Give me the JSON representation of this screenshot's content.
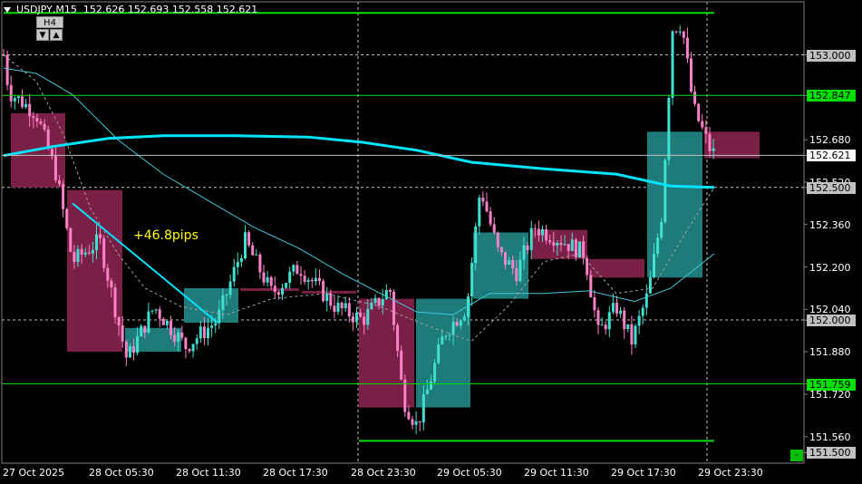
{
  "header": {
    "symbol_tf": "USDJPY,M15",
    "ohlc": "152.626 152.693 152.558 152.621"
  },
  "timeframe_widget": {
    "label": "H4",
    "down_label": "▼",
    "up_label": "▲"
  },
  "annotation": "+46.8pips",
  "minus_button": "-",
  "colors": {
    "background": "#000000",
    "bull_candle": "#40e0d0",
    "bear_candle": "#ff82c8",
    "h4_bear_box": "#7a1f45",
    "h4_bull_box": "#1f7a7a",
    "ma_slow": "#00e5ff",
    "ma_fast": "#40c8d8",
    "level_line": "#00dd00",
    "grid": "#c0c0c0",
    "annotation": "#ffff00"
  },
  "price_axis": {
    "labels": [
      "153.000",
      "152.847",
      "152.680",
      "152.621",
      "152.520",
      "152.500",
      "152.360",
      "152.200",
      "152.040",
      "152.000",
      "151.880",
      "151.759",
      "151.720",
      "151.560",
      "151.500"
    ],
    "label_styles": [
      "box-gray",
      "box-green",
      "plain",
      "box-white",
      "plain",
      "box-gray",
      "plain",
      "plain",
      "plain",
      "box-gray",
      "plain",
      "box-green",
      "plain",
      "plain",
      "box-gray"
    ],
    "range": [
      151.46,
      153.2
    ]
  },
  "time_axis": {
    "labels": [
      "27 Oct 2025",
      "28 Oct 05:30",
      "28 Oct 11:30",
      "28 Oct 17:30",
      "28 Oct 23:30",
      "29 Oct 05:30",
      "29 Oct 11:30",
      "29 Oct 17:30",
      "29 Oct 23:30"
    ]
  },
  "levels": {
    "horizontal_green": [
      153.158,
      152.847,
      151.759,
      151.544
    ],
    "horizontal_gray_dashed": [
      153.0,
      152.5,
      152.0
    ],
    "current_price": 152.621
  },
  "h4_boxes": [
    {
      "dir": "bear",
      "o": 152.78,
      "c": 152.5
    },
    {
      "dir": "bear",
      "o": 152.49,
      "c": 151.88
    },
    {
      "dir": "bull",
      "o": 151.88,
      "c": 151.97
    },
    {
      "dir": "bull",
      "o": 151.99,
      "c": 152.12
    },
    {
      "dir": "bear",
      "o": 152.12,
      "c": 152.11
    },
    {
      "dir": "bear",
      "o": 152.11,
      "c": 152.1
    },
    {
      "dir": "bear",
      "o": 152.08,
      "c": 151.67
    },
    {
      "dir": "bull",
      "o": 151.67,
      "c": 152.08
    },
    {
      "dir": "bull",
      "o": 152.08,
      "c": 152.33
    },
    {
      "dir": "bear",
      "o": 152.34,
      "c": 152.23
    },
    {
      "dir": "bear",
      "o": 152.23,
      "c": 152.16
    },
    {
      "dir": "bull",
      "o": 152.16,
      "c": 152.71
    },
    {
      "dir": "bear",
      "o": 152.71,
      "c": 152.61
    }
  ]
}
